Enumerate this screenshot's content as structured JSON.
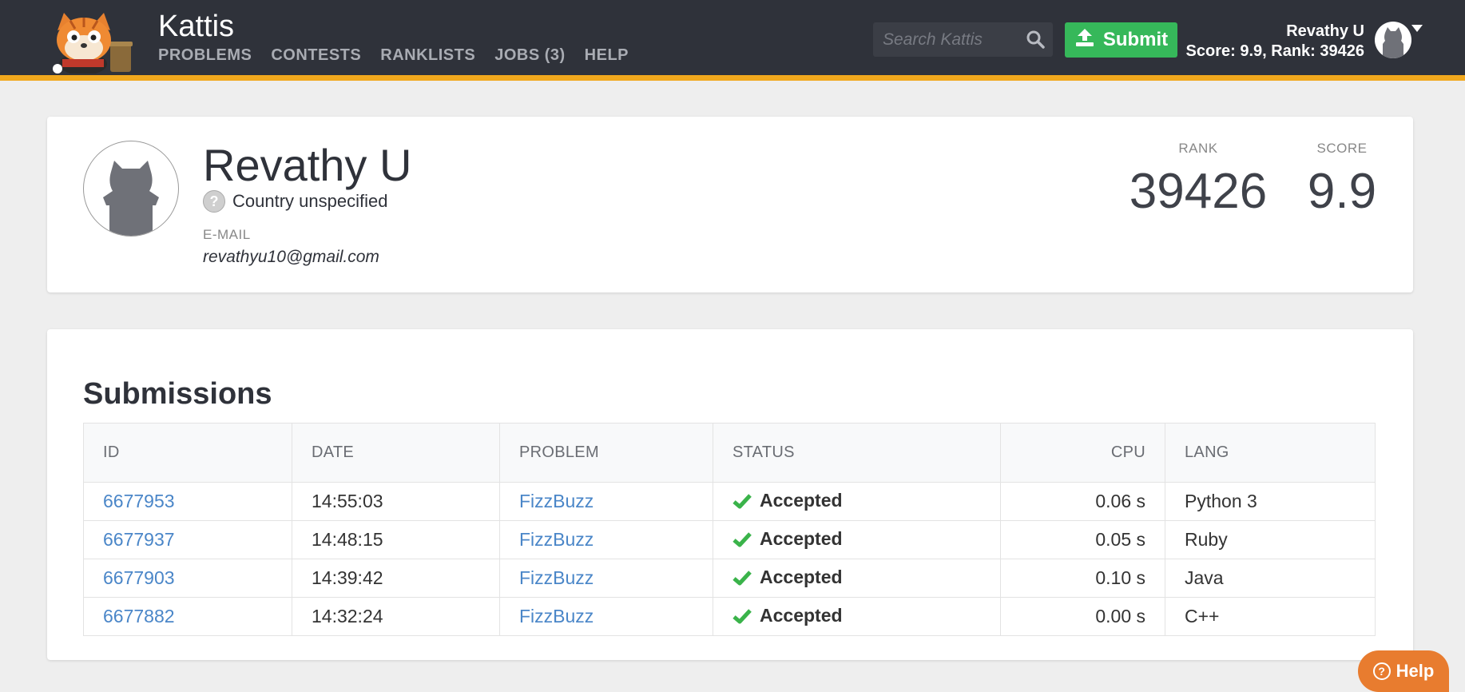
{
  "header": {
    "brand": "Kattis",
    "nav": [
      "PROBLEMS",
      "CONTESTS",
      "RANKLISTS",
      "JOBS (3)",
      "HELP"
    ],
    "search_placeholder": "Search Kattis",
    "submit_label": "Submit",
    "user_name": "Revathy U",
    "user_stats": "Score: 9.9, Rank: 39426"
  },
  "profile": {
    "name": "Revathy U",
    "country": "Country unspecified",
    "email_label": "E-MAIL",
    "email": "revathyu10@gmail.com",
    "rank_label": "RANK",
    "rank": "39426",
    "score_label": "SCORE",
    "score": "9.9"
  },
  "submissions": {
    "title": "Submissions",
    "columns": [
      "ID",
      "DATE",
      "PROBLEM",
      "STATUS",
      "CPU",
      "LANG"
    ],
    "rows": [
      {
        "id": "6677953",
        "date": "14:55:03",
        "problem": "FizzBuzz",
        "status": "Accepted",
        "cpu": "0.06 s",
        "lang": "Python 3"
      },
      {
        "id": "6677937",
        "date": "14:48:15",
        "problem": "FizzBuzz",
        "status": "Accepted",
        "cpu": "0.05 s",
        "lang": "Ruby"
      },
      {
        "id": "6677903",
        "date": "14:39:42",
        "problem": "FizzBuzz",
        "status": "Accepted",
        "cpu": "0.10 s",
        "lang": "Java"
      },
      {
        "id": "6677882",
        "date": "14:32:24",
        "problem": "FizzBuzz",
        "status": "Accepted",
        "cpu": "0.00 s",
        "lang": "C++"
      }
    ]
  },
  "help_label": "Help",
  "colors": {
    "header_bg": "#2f323a",
    "accent_bar": "#f1a81d",
    "submit_green": "#36b85a",
    "accepted_green": "#3ab34a",
    "link_blue": "#4a86c8",
    "help_orange": "#e87c2f"
  },
  "icons": {
    "logo": "kattis-cat-logo",
    "search": "search-icon",
    "upload": "upload-icon",
    "check": "check-icon",
    "question": "question-icon"
  }
}
